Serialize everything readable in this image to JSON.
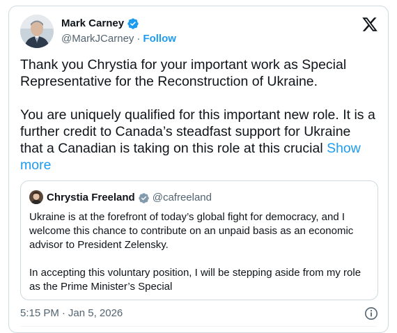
{
  "author": {
    "name": "Mark Carney",
    "handle": "@MarkJCarney",
    "separator": "·",
    "follow_label": "Follow"
  },
  "post": {
    "paragraph1": "Thank you Chrystia for your important work as Special Representative for the Reconstruction of Ukraine.",
    "paragraph2": "You are uniquely qualified for this important new role. It is a further credit to Canada’s steadfast support for Ukraine that a Canadian is taking on this role at this crucial",
    "show_more_label": "Show more"
  },
  "quoted": {
    "name": "Chrystia Freeland",
    "handle": "@cafreeland",
    "paragraph1": "Ukraine is at the forefront of today’s global fight for democracy, and I welcome this chance to contribute on an unpaid basis as an economic advisor to President Zelensky.",
    "paragraph2": "In accepting this voluntary position, I will be stepping aside from my role as the Prime Minister’s Special"
  },
  "meta": {
    "time": "5:15 PM",
    "separator": "·",
    "date": "Jan 5, 2026"
  },
  "colors": {
    "accent": "#1d9bf0",
    "text": "#0f1419",
    "muted": "#536471",
    "border": "#cfd9de",
    "verified_gold": "#1d9bf0"
  },
  "icons": {
    "verified": "verified-badge-icon",
    "x_logo": "x-logo-icon",
    "info": "info-icon"
  }
}
